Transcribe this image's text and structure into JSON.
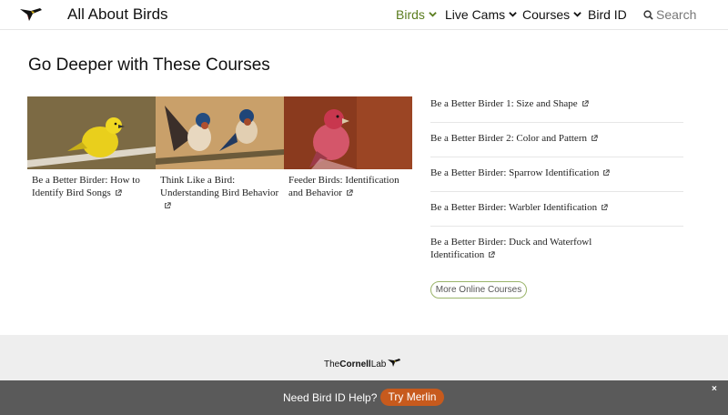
{
  "header": {
    "site_title": "All About Birds",
    "nav": [
      {
        "label": "Birds",
        "active": true,
        "has_dropdown": true
      },
      {
        "label": "Live Cams",
        "active": false,
        "has_dropdown": true
      },
      {
        "label": "Courses",
        "active": false,
        "has_dropdown": true
      },
      {
        "label": "Bird ID",
        "active": false,
        "has_dropdown": false
      }
    ],
    "search_label": "Search",
    "accent_color": "#5b7d1f"
  },
  "main": {
    "section_title": "Go Deeper with These Courses",
    "cards": [
      {
        "title": "Be a Better Birder: How to Identify Bird Songs",
        "image": "yellow-warbler-photo"
      },
      {
        "title": "Think Like a Bird: Understanding Bird Behavior",
        "image": "barn-swallows-photo"
      },
      {
        "title": "Feeder Birds: Identification and Behavior",
        "image": "purple-finch-photo"
      }
    ],
    "course_links": [
      "Be a Better Birder 1: Size and Shape",
      "Be a Better Birder 2: Color and Pattern",
      "Be a Better Birder: Sparrow Identification",
      "Be a Better Birder: Warbler Identification",
      "Be a Better Birder: Duck and Waterfowl Identification"
    ],
    "more_button": "More Online Courses"
  },
  "footer": {
    "logo_the": "The",
    "logo_cornell": "Cornell",
    "logo_lab": "Lab"
  },
  "banner": {
    "text": "Need Bird ID Help?",
    "button": "Try Merlin",
    "close": "×",
    "button_color": "#c75a1d"
  }
}
